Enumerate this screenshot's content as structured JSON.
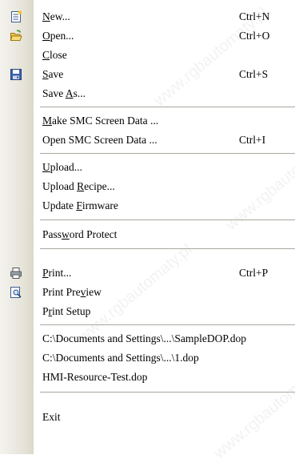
{
  "menu": {
    "items": [
      {
        "label": "New...",
        "mnemonic_index": 0,
        "shortcut": "Ctrl+N",
        "icon": "new-file-icon"
      },
      {
        "label": "Open...",
        "mnemonic_index": 0,
        "shortcut": "Ctrl+O",
        "icon": "open-folder-icon"
      },
      {
        "label": "Close",
        "mnemonic_index": 0,
        "shortcut": ""
      },
      {
        "label": "Save",
        "mnemonic_index": 0,
        "shortcut": "Ctrl+S",
        "icon": "save-disk-icon"
      },
      {
        "label": "Save As...",
        "mnemonic_index": 5,
        "shortcut": ""
      },
      {
        "label": "Make SMC Screen Data ...",
        "mnemonic_index": 0,
        "shortcut": ""
      },
      {
        "label": "Open SMC Screen Data ...",
        "mnemonic_index": -1,
        "shortcut": "Ctrl+I"
      },
      {
        "label": "Upload...",
        "mnemonic_index": 0,
        "shortcut": ""
      },
      {
        "label": "Upload Recipe...",
        "mnemonic_index": 7,
        "shortcut": ""
      },
      {
        "label": "Update Firmware",
        "mnemonic_index": 7,
        "shortcut": ""
      },
      {
        "label": "Password Protect",
        "mnemonic_index": 4,
        "shortcut": ""
      },
      {
        "label": "Print...",
        "mnemonic_index": 0,
        "shortcut": "Ctrl+P",
        "icon": "printer-icon"
      },
      {
        "label": "Print Preview",
        "mnemonic_index": 9,
        "shortcut": "",
        "icon": "print-preview-icon"
      },
      {
        "label": "Print Setup",
        "mnemonic_index": 1,
        "shortcut": ""
      },
      {
        "label": "C:\\Documents and Settings\\...\\SampleDOP.dop",
        "mnemonic_index": -1,
        "shortcut": ""
      },
      {
        "label": "C:\\Documents and Settings\\...\\1.dop",
        "mnemonic_index": -1,
        "shortcut": ""
      },
      {
        "label": "HMI-Resource-Test.dop",
        "mnemonic_index": -1,
        "shortcut": ""
      },
      {
        "label": "Exit",
        "mnemonic_index": -1,
        "shortcut": ""
      }
    ]
  },
  "watermark": "www.rgbautomaty.pl"
}
